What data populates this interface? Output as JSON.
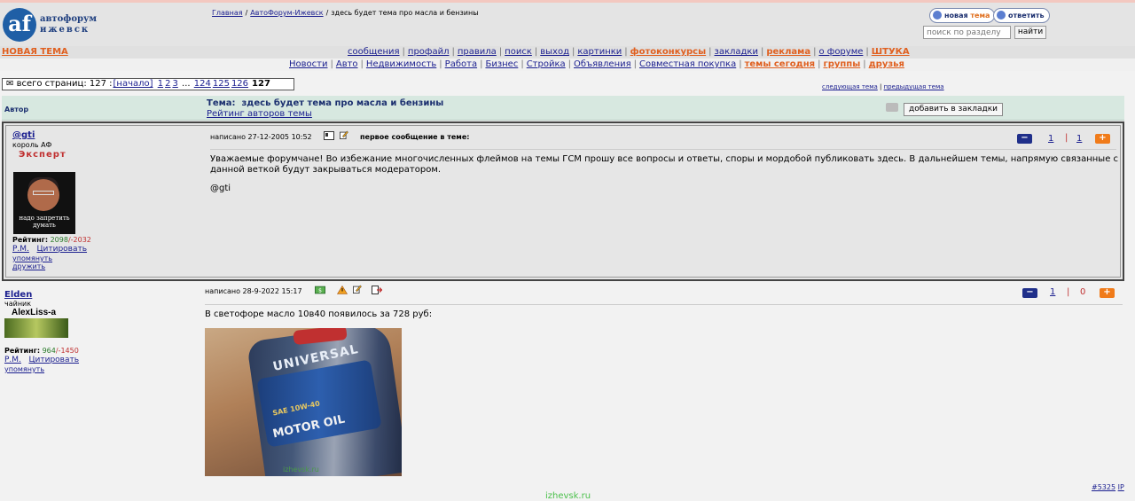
{
  "logo": {
    "letters": "af",
    "line1": "автофорум",
    "line2": "ижевск"
  },
  "breadcrumbs": {
    "home": "Главная",
    "sep": "/",
    "forum": "АвтоФорум-Ижевск",
    "current": "здесь будет тема про масла и бензины"
  },
  "buttons": {
    "new_topic_prefix": "новая",
    "new_topic_accent": "тема",
    "reply": "ответить"
  },
  "search": {
    "placeholder": "поиск по разделу",
    "button": "найти"
  },
  "nav": {
    "new_topic": "НОВАЯ ТЕМА",
    "row1": [
      "сообщения",
      "профайл",
      "правила",
      "поиск",
      "выход",
      "картинки",
      "фотоконкурсы",
      "закладки",
      "реклама",
      "о форуме",
      "ШТУКА"
    ],
    "row1_hot": [
      6,
      8,
      10
    ],
    "row2": [
      "Новости",
      "Авто",
      "Недвижимость",
      "Работа",
      "Бизнес",
      "Стройка",
      "Объявления",
      "Совместная покупка",
      "темы сегодня",
      "группы",
      "друзья"
    ],
    "row2_hot": [
      8,
      9,
      10
    ]
  },
  "pager": {
    "label": "всего страниц: 127 :",
    "start": "[начало]",
    "pages": [
      "1",
      "2",
      "3"
    ],
    "ellipsis": "...",
    "pages2": [
      "124",
      "125",
      "126"
    ],
    "current": "127"
  },
  "topic_nav": {
    "next": "следующая тема",
    "sep": "|",
    "prev": "предыдущая тема"
  },
  "header": {
    "author": "Автор",
    "topic_label": "Тема:",
    "topic_title": "здесь будет тема про масла и бензины",
    "rating_link": "Рейтинг авторов темы",
    "bookmark": "добавить в закладки"
  },
  "post1": {
    "username": "@gti",
    "title": "король АФ",
    "rank": "Эксперт",
    "avatar_caption": "надо запретить думать",
    "rating_label": "Рейтинг:",
    "rating_pos": "2098",
    "rating_neg": "/-2032",
    "pm": "Р.М.",
    "quote": "Цитировать",
    "mention": "упомянуть",
    "friend": "дружить",
    "date": "написано 27-12-2005 10:52",
    "first_msg": "первое сообщение в теме:",
    "vote_minus": "1",
    "vote_plus": "1",
    "text": "Уважаемые форумчане! Во избежание многочисленных флеймов на темы ГСМ прошу все вопросы и ответы, споры и мордобой публиковать здесь. В дальнейшем темы, напрямую связанные с данной веткой будут закрываться модератором.",
    "signature": "@gti"
  },
  "post2": {
    "username": "Elden",
    "title": "чайник",
    "avatar_name": "AlexLiss-a",
    "rating_label": "Рейтинг:",
    "rating_pos": "964",
    "rating_neg": "/-1450",
    "pm": "Р.М.",
    "quote": "Цитировать",
    "mention": "упомянуть",
    "date": "написано 28-9-2022 15:17",
    "vote_minus": "1",
    "vote_plus": "0",
    "text": "В светофоре масло 10в40 появилось за 728 руб:",
    "photo_text1": "UNIVERSAL",
    "photo_text2": "SAE 10W-40",
    "photo_text3": "MOTOR OIL",
    "photo_watermark": "izhevsk.ru",
    "post_id": "#5325",
    "ip": "IP"
  },
  "footer_watermark": "izhevsk.ru",
  "colors": {
    "accent": "#e06020",
    "link": "#1b1f8f",
    "header_bg": "#d7e8e0",
    "minus_btn": "#1f2f8a",
    "plus_btn": "#f07b1a"
  }
}
